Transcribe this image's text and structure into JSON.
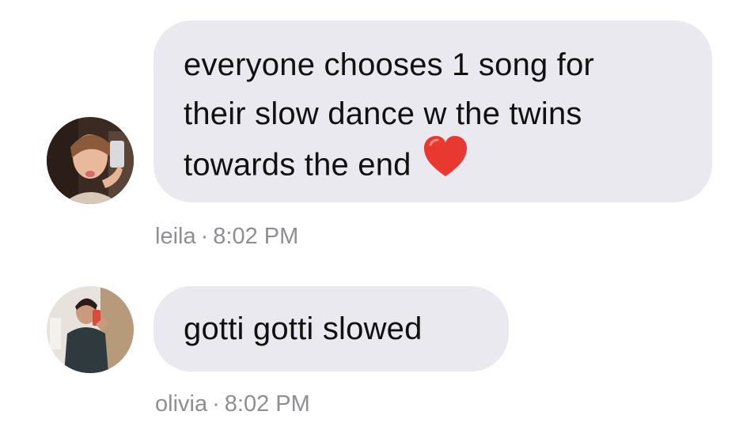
{
  "messages": [
    {
      "sender": "leila",
      "time": "8:02 PM",
      "separator": "·",
      "lines": [
        "everyone chooses 1 song for",
        "their slow dance w the twins",
        "towards the end"
      ],
      "emoji": "heart-emoji"
    },
    {
      "sender": "olivia",
      "time": "8:02 PM",
      "separator": "·",
      "lines": [
        "gotti gotti slowed"
      ]
    }
  ],
  "colors": {
    "bubble": "#e9e9ef",
    "text": "#111111",
    "meta": "#8e8e93",
    "heart": "#e8382f"
  }
}
